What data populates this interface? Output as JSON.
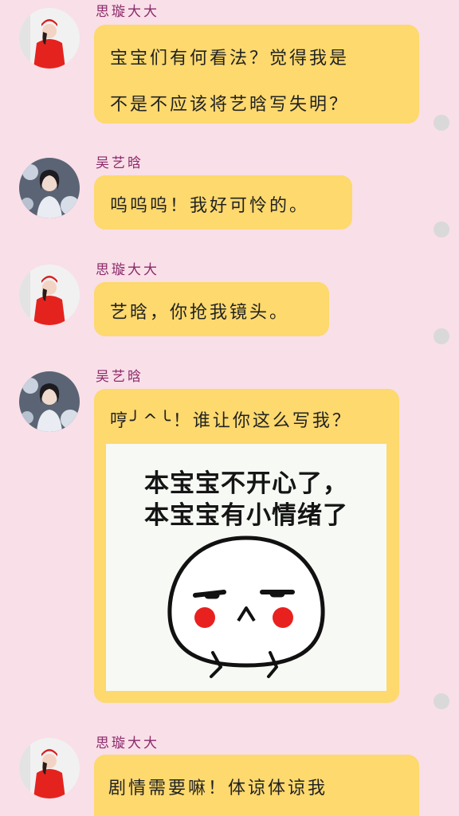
{
  "chat": {
    "messages": [
      {
        "sender": "思璇大大",
        "avatar": "avatar-red-hoodie",
        "lines": [
          "宝宝们有何看法？觉得我是",
          "不是不应该将艺晗写失明？"
        ]
      },
      {
        "sender": "吴艺晗",
        "avatar": "avatar-snow-portrait",
        "lines": [
          "呜呜呜！我好可怜的。"
        ]
      },
      {
        "sender": "思璇大大",
        "avatar": "avatar-red-hoodie",
        "lines": [
          "艺晗，你抢我镜头。"
        ]
      },
      {
        "sender": "吴艺晗",
        "avatar": "avatar-snow-portrait",
        "lines": [
          "哼╯^╰！谁让你这么写我？"
        ],
        "sticker": {
          "caption_line1": "本宝宝不开心了，",
          "caption_line2": "本宝宝有小情绪了",
          "icon": "pouting-face-sticker"
        }
      },
      {
        "sender": "思璇大大",
        "avatar": "avatar-red-hoodie",
        "lines": [
          "剧情需要嘛！体谅体谅我"
        ]
      }
    ]
  },
  "colors": {
    "background": "#f9dfe8",
    "bubble": "#fdd96e",
    "sender_name": "#8c2a6a",
    "status_dot": "#d9d9d9"
  }
}
